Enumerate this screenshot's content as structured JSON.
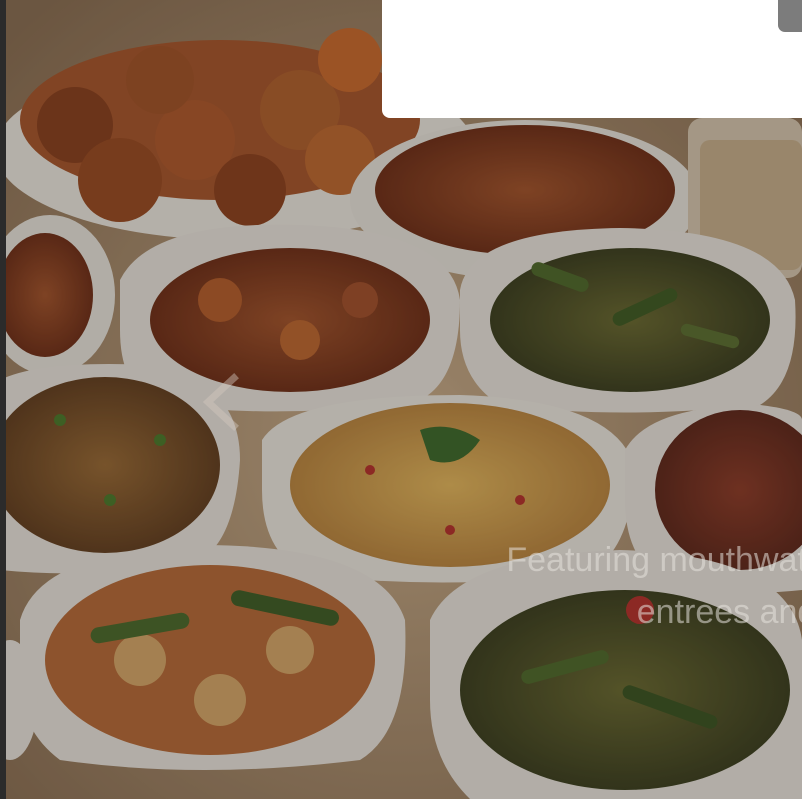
{
  "carousel": {
    "caption": "Featuring mouthwatering main entrees and f",
    "image_icon": "food-photo-image",
    "prev_icon": "chevron-left-icon"
  },
  "colors": {
    "overlay": "#1e1a16",
    "modal": "#ffffff",
    "caption": "#e6e2dc"
  }
}
